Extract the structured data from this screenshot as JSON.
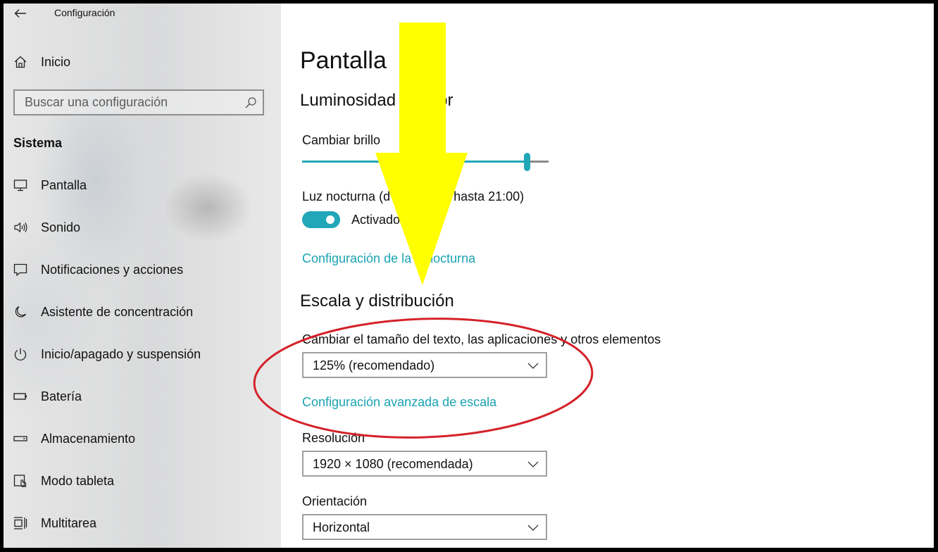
{
  "window": {
    "title": "Configuración"
  },
  "sidebar": {
    "home_label": "Inicio",
    "search": {
      "placeholder": "Buscar una configuración"
    },
    "section_title": "Sistema",
    "items": [
      {
        "label": "Pantalla",
        "icon": "monitor-icon"
      },
      {
        "label": "Sonido",
        "icon": "speaker-icon"
      },
      {
        "label": "Notificaciones y acciones",
        "icon": "notification-icon"
      },
      {
        "label": "Asistente de concentración",
        "icon": "moon-icon"
      },
      {
        "label": "Inicio/apagado y suspensión",
        "icon": "power-icon"
      },
      {
        "label": "Batería",
        "icon": "battery-icon"
      },
      {
        "label": "Almacenamiento",
        "icon": "storage-icon"
      },
      {
        "label": "Modo tableta",
        "icon": "tablet-mode-icon"
      },
      {
        "label": "Multitarea",
        "icon": "multitasking-icon"
      }
    ]
  },
  "main": {
    "page_title": "Pantalla",
    "brightness": {
      "heading": "Luminosidad y color",
      "heading_visible": "Luminosidad",
      "heading_tail": "or",
      "label": "Cambiar brillo",
      "value_fraction": 0.91
    },
    "night_light": {
      "label_start": "Luz nocturna (d",
      "label_end": "hasta 21:00)",
      "toggle_label": "Activado",
      "toggle_on": true,
      "link_start": "Configuración de la",
      "link_end": "z nocturna"
    },
    "scale": {
      "heading": "Escala y distribución",
      "label": "Cambiar el tamaño del texto, las aplicaciones y otros elementos",
      "value": "125% (recomendado)",
      "advanced_link": "Configuración avanzada de escala"
    },
    "resolution": {
      "label": "Resolución",
      "value": "1920 × 1080 (recomendada)"
    },
    "orientation": {
      "label": "Orientación",
      "value": "Horizontal"
    }
  },
  "colors": {
    "accent": "#1aa3b3",
    "annotation_arrow": "#ffff00",
    "annotation_ellipse": "#d42229"
  }
}
